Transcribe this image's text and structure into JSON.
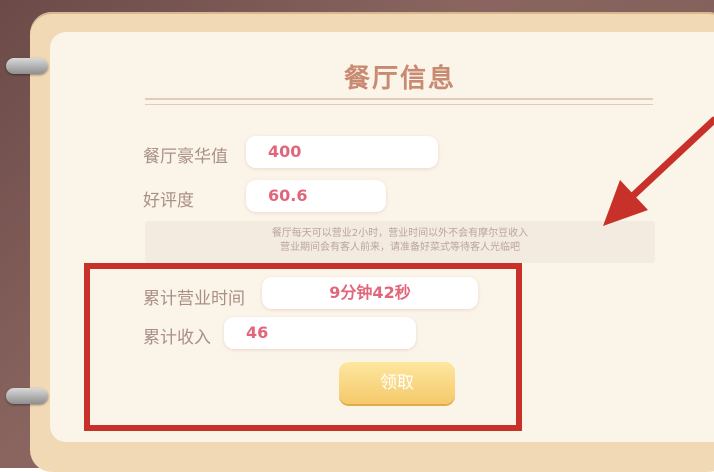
{
  "panel": {
    "title": "餐厅信息"
  },
  "stats": {
    "luxury_label": "餐厅豪华值",
    "luxury_value": "400",
    "rating_label": "好评度",
    "rating_value": "60.6"
  },
  "note": {
    "line1": "餐厅每天可以营业2小时，营业时间以外不会有摩尔豆收入",
    "line2": "营业期间会有客人前来，请准备好菜式等待客人光临吧"
  },
  "earnings": {
    "time_label": "累计营业时间",
    "time_value": "9分钟42秒",
    "income_label": "累计收入",
    "income_value": "46",
    "claim_label": "领取"
  },
  "annotation": {
    "highlight_color": "#c8302a"
  }
}
